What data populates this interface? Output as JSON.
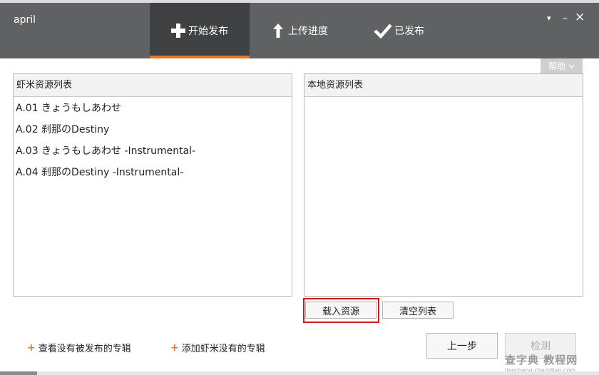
{
  "app": {
    "username": "april"
  },
  "tabs": [
    {
      "label": "开始发布",
      "icon": "plus-icon",
      "active": true
    },
    {
      "label": "上传进度",
      "icon": "arrow-up-icon",
      "active": false
    },
    {
      "label": "已发布",
      "icon": "check-icon",
      "active": false
    }
  ],
  "window_controls": {
    "menu": "▾",
    "minimize": "–",
    "close": "×"
  },
  "help": {
    "label": "帮助"
  },
  "left_panel": {
    "title": "虾米资源列表",
    "items": [
      "A.01  きょうもしあわせ",
      "A.02  刹那のDestiny",
      "A.03  きょうもしあわせ -Instrumental-",
      "A.04  刹那のDestiny -Instrumental-"
    ]
  },
  "right_panel": {
    "title": "本地资源列表",
    "items": []
  },
  "buttons": {
    "load_resources": "载入资源",
    "clear_list": "清空列表",
    "previous_step": "上一步",
    "detect": "检测"
  },
  "links": {
    "view_unpublished": "查看没有被发布的专辑",
    "add_missing": "添加虾米没有的专辑"
  },
  "watermark": {
    "main": "查字典 教程网",
    "sub": "jiaocheng.chazidian.com"
  },
  "colors": {
    "topbar": "#5f6163",
    "active_tab": "#3f4143",
    "accent": "#e8762b",
    "highlight_border": "#d3171a"
  }
}
